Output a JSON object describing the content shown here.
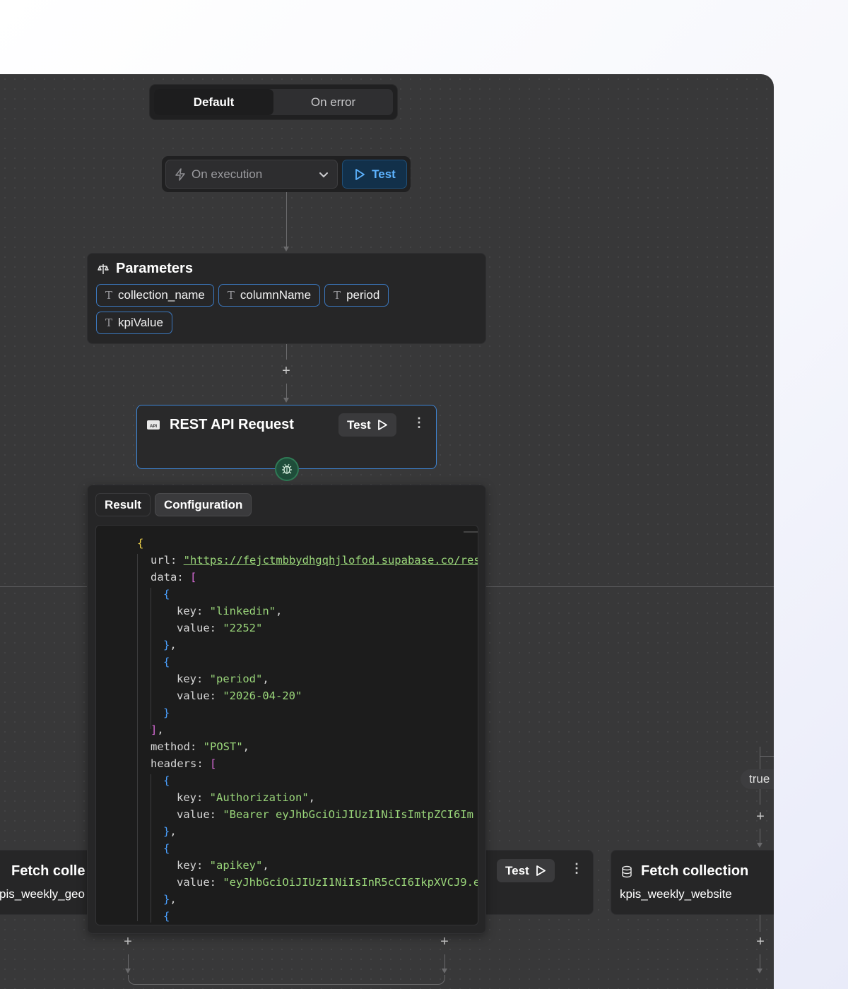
{
  "segment": {
    "options": [
      "Default",
      "On error"
    ],
    "active": "Default"
  },
  "trigger": {
    "select_value": "On execution",
    "test_label": "Test"
  },
  "parameters": {
    "title": "Parameters",
    "items": [
      "collection_name",
      "columnName",
      "period",
      "kpiValue"
    ]
  },
  "rest_node": {
    "title": "REST API Request",
    "test_label": "Test"
  },
  "result_panel": {
    "tabs": [
      "Result",
      "Configuration"
    ],
    "active_tab": "Configuration",
    "code": {
      "url": "\"https://fejctmbbydhgqhjlofod.supabase.co/res",
      "data_items": [
        {
          "key": "\"linkedin\"",
          "value": "\"2252\""
        },
        {
          "key": "\"period\"",
          "value": "\"2026-04-20\""
        }
      ],
      "method": "\"POST\"",
      "headers": [
        {
          "key": "\"Authorization\"",
          "value": "\"Bearer eyJhbGciOiJIUzI1NiIsImtpZCI6Im"
        },
        {
          "key": "\"apikey\"",
          "value": "\"eyJhbGciOiJIUzI1NiIsInR5cCI6IkpXVCJ9.e"
        }
      ]
    }
  },
  "bottom_nodes": {
    "left": {
      "title": "Fetch colle",
      "subtitle": "pis_weekly_geo"
    },
    "middle": {
      "test_label": "Test"
    },
    "right": {
      "title": "Fetch collection",
      "subtitle": "kpis_weekly_website"
    }
  },
  "branch_label": "true",
  "icons": [
    "lightning-icon",
    "chevron-down-icon",
    "play-icon",
    "scale-icon",
    "text-type-icon",
    "api-icon",
    "kebab-icon",
    "bug-icon",
    "database-icon",
    "plus-icon"
  ],
  "colors": {
    "accent_blue": "#3e86d6",
    "canvas": "#383839",
    "node": "#262627"
  }
}
